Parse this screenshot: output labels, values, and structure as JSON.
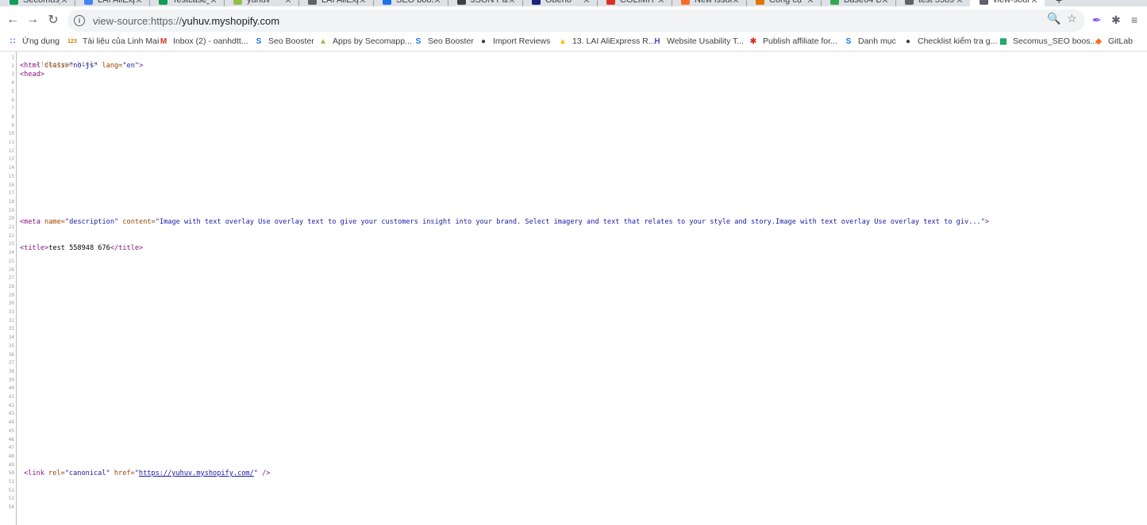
{
  "tabs": [
    {
      "title": "Secomus_",
      "color": "#0f9d58"
    },
    {
      "title": "LAI AliExp",
      "color": "#4285f4"
    },
    {
      "title": "Testcase_d",
      "color": "#0f9d58"
    },
    {
      "title": "yuhuv",
      "color": "#96bf48"
    },
    {
      "title": "LAI AliExp",
      "color": "#5f6368"
    },
    {
      "title": "SEO boost",
      "color": "#1a73e8"
    },
    {
      "title": "JSON Parse",
      "color": "#3c4043"
    },
    {
      "title": "Oberlo",
      "color": "#1a237e"
    },
    {
      "title": "COLIMIT",
      "color": "#d93025"
    },
    {
      "title": "New issue",
      "color": "#fc6d26"
    },
    {
      "title": "Công cụ",
      "color": "#e37400"
    },
    {
      "title": "Base64 De",
      "color": "#34a853"
    },
    {
      "title": "test 5589",
      "color": "#5f6368"
    },
    {
      "title": "view-sourc",
      "color": "#5f6368",
      "active": true
    }
  ],
  "toolbar": {
    "back_icon": "arrow-left-icon",
    "forward_icon": "arrow-right-icon",
    "reload_icon": "reload-icon",
    "url_scheme": "view-source:https://",
    "url_host": "yuhuv.myshopify.com"
  },
  "bookmarks": [
    {
      "label": "Ứng dụng",
      "icon": "apps-grid-icon",
      "color": "#1a73e8"
    },
    {
      "label": "Tài liệu của Linh Mai",
      "icon": "123-icon",
      "color": "#e37400"
    },
    {
      "label": "Inbox (2) - oanhdtt...",
      "icon": "gmail-icon",
      "color": "#d93025"
    },
    {
      "label": "Seo Booster",
      "icon": "seo-booster-icon",
      "color": "#1a73e8"
    },
    {
      "label": "Apps by Secomapp...",
      "icon": "shopify-icon",
      "color": "#96bf48"
    },
    {
      "label": "Seo Booster",
      "icon": "seo-booster-icon",
      "color": "#1a73e8"
    },
    {
      "label": "Import Reviews",
      "icon": "globe-icon",
      "color": "#3c4043"
    },
    {
      "label": "13. LAI AliExpress R...",
      "icon": "drive-icon",
      "color": "#fbbc04"
    },
    {
      "label": "Website Usability T...",
      "icon": "usability-icon",
      "color": "#673ab7"
    },
    {
      "label": "Publish affiliate for...",
      "icon": "affiliate-icon",
      "color": "#d93025"
    },
    {
      "label": "Danh mục",
      "icon": "seo-booster-icon",
      "color": "#1a73e8"
    },
    {
      "label": "Checklist kiểm tra g...",
      "icon": "globe-icon",
      "color": "#3c4043"
    },
    {
      "label": "Secomus_SEO boos...",
      "icon": "sheets-icon",
      "color": "#0f9d58"
    },
    {
      "label": "GitLab",
      "icon": "gitlab-icon",
      "color": "#fc6d26"
    }
  ],
  "source": {
    "line_count": 54,
    "l1": "<!doctype html>",
    "l2_tag_open": "<html ",
    "l2_attr1": "class=",
    "l2_val1": "\"no-js\"",
    "l2_attr2": " lang=",
    "l2_val2": "\"en\"",
    "l2_close": ">",
    "l3": "<head>",
    "l20_tag": "<meta ",
    "l20_attr1": "name=",
    "l20_val1": "\"description\"",
    "l20_attr2": " content=",
    "l20_val2": "\"Image with text overlay Use overlay text to give your customers insight into your brand. Select imagery and text that relates to your style and story.Image with text overlay Use overlay text to giv...\"",
    "l20_close": ">",
    "l23_open": "<title>",
    "l23_text": "test 558948 676",
    "l23_close": "</title>",
    "l49_tag": "<link ",
    "l49_attr1": "rel=",
    "l49_val1": "\"canonical\"",
    "l49_attr2": " href=",
    "l49_q1": "\"",
    "l49_href": "https://yuhuv.myshopify.com/",
    "l49_q2": "\"",
    "l49_close": " />"
  }
}
